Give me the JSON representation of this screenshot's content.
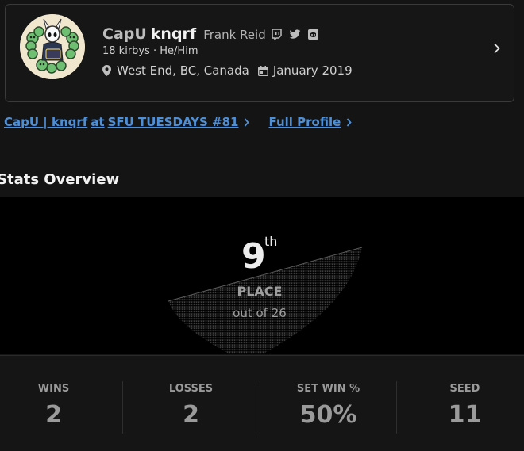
{
  "profile": {
    "prefix": "CapU",
    "gamertag": "knqrf",
    "real_name": "Frank Reid",
    "social_icons": [
      "twitch-icon",
      "twitter-icon",
      "discord-icon"
    ],
    "meta": "18 kirbys · He/Him",
    "location": "West End, BC, Canada",
    "joined": "January 2019"
  },
  "links": {
    "entrant_prefix": "CapU | knqrf",
    "entrant_at": "at",
    "tournament": "SFU TUESDAYS #81",
    "full_profile": "Full Profile"
  },
  "section_title": "Stats Overview",
  "placement": {
    "number": "9",
    "suffix": "th",
    "label": "PLACE",
    "out_of": "out of 26"
  },
  "stats": [
    {
      "label": "WINS",
      "value": "2"
    },
    {
      "label": "LOSSES",
      "value": "2"
    },
    {
      "label": "SET WIN %",
      "value": "50%"
    },
    {
      "label": "SEED",
      "value": "11"
    }
  ],
  "colors": {
    "link": "#4f8fd6",
    "background": "#141414",
    "panel": "#000000"
  }
}
